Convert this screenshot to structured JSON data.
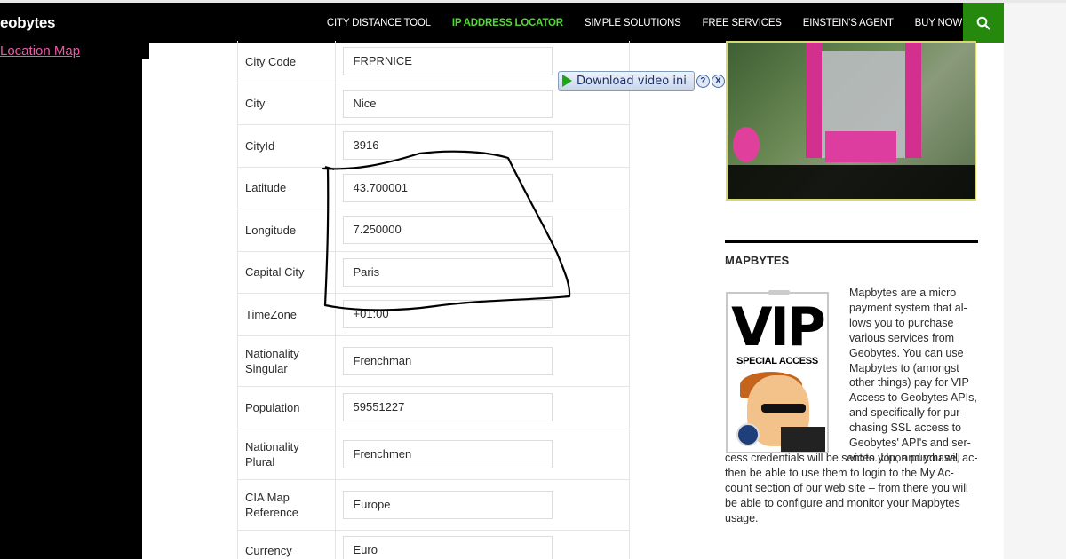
{
  "site": {
    "brand": "eobytes"
  },
  "nav": {
    "items": [
      {
        "label": "CITY DISTANCE TOOL",
        "active": false
      },
      {
        "label": "IP ADDRESS LOCATOR",
        "active": true
      },
      {
        "label": "SIMPLE SOLUTIONS",
        "active": false
      },
      {
        "label": "FREE SERVICES",
        "active": false
      },
      {
        "label": "EINSTEIN'S AGENT",
        "active": false
      },
      {
        "label": "BUY NOW",
        "active": false
      }
    ],
    "search_icon": "search-icon"
  },
  "sidebar": {
    "location_map_link": "Location Map"
  },
  "details": {
    "rows": [
      {
        "label": "City Code",
        "value": "FRPRNICE"
      },
      {
        "label": "City",
        "value": "Nice"
      },
      {
        "label": "CityId",
        "value": "3916"
      },
      {
        "label": "Latitude",
        "value": "43.700001"
      },
      {
        "label": "Longitude",
        "value": "7.250000"
      },
      {
        "label": "Capital City",
        "value": "Paris"
      },
      {
        "label": "TimeZone",
        "value": "+01:00"
      },
      {
        "label": "Nationality Singular",
        "value": "Frenchman"
      },
      {
        "label": "Population",
        "value": "59551227"
      },
      {
        "label": "Nationality Plural",
        "value": "Frenchmen"
      },
      {
        "label": "CIA Map Reference",
        "value": "Europe"
      },
      {
        "label": "Currency",
        "value": "Euro"
      }
    ]
  },
  "download_bar": {
    "label": "Download video ini",
    "help": "?",
    "close": "X"
  },
  "widget": {
    "title": "MAPBYTES",
    "vip_title": "VIP",
    "vip_subtitle": "SPECIAL ACCESS",
    "text_lines_right": [
      "Mapbytes are a micro",
      "payment system that al-",
      "lows you to purchase",
      "various services from",
      "Geobytes. You can use",
      "Mapbytes to (amongst",
      "other things) pay for VIP",
      "Access to Geobytes APIs,",
      "and specifically for pur-",
      "chasing SSL access to",
      "Geobytes' API's and ser-",
      "vices. Upon purchase, ac-"
    ],
    "text_lines_full": [
      "cess credentials will be sent to you, and you will",
      "then be able to use them to login to the My Ac-",
      "count section of our web site – from there you will",
      "be able to configure and monitor your Mapbytes",
      "usage."
    ]
  },
  "colors": {
    "nav_active": "#55d737",
    "search_bg": "#24890d",
    "link_pink": "#e85aa6"
  }
}
